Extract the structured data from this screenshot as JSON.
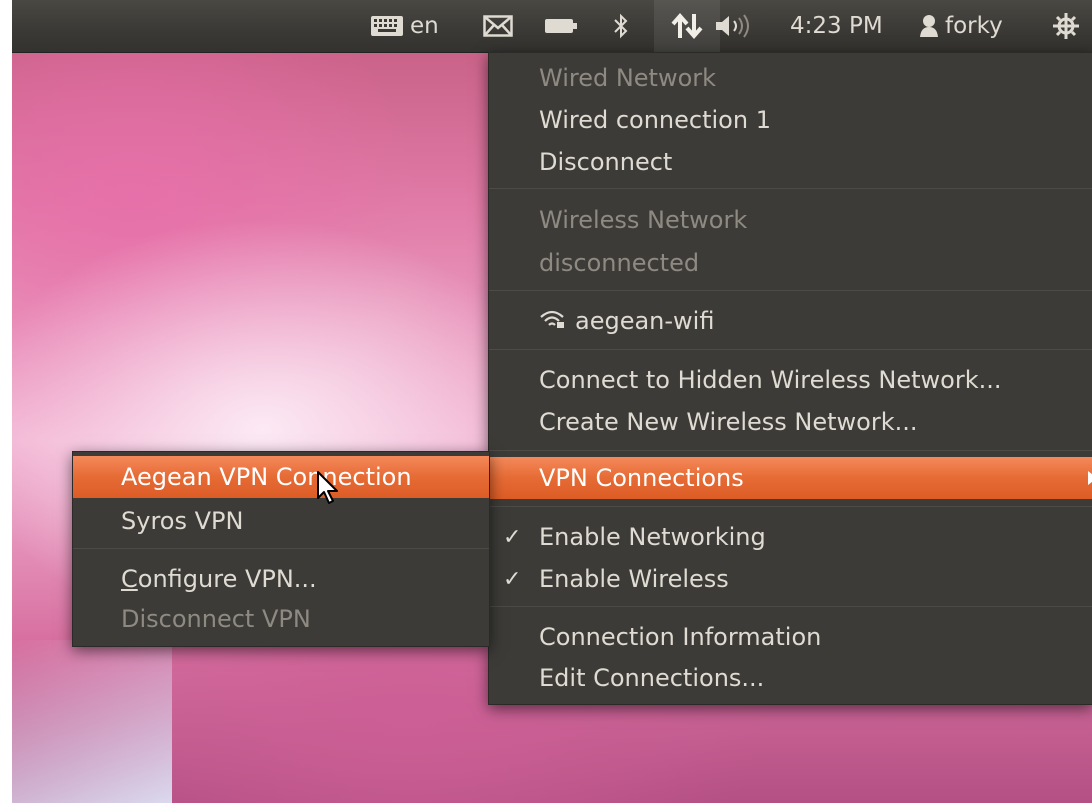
{
  "panel": {
    "keyboard_layout": "en",
    "time": "4:23 PM",
    "user": "forky",
    "icons": [
      "keyboard-icon",
      "mail-icon",
      "battery-icon",
      "bluetooth-icon",
      "network-icon",
      "volume-icon",
      "user-icon",
      "power-icon"
    ]
  },
  "network_menu": {
    "wired_header": "Wired Network",
    "wired_connection": "Wired connection 1",
    "disconnect": "Disconnect",
    "wireless_header": "Wireless Network",
    "wireless_status": "disconnected",
    "wifi_network": "aegean-wifi",
    "connect_hidden": "Connect to Hidden Wireless Network...",
    "create_new": "Create New Wireless Network...",
    "vpn_connections": "VPN Connections",
    "enable_networking": "Enable Networking",
    "enable_wireless": "Enable Wireless",
    "connection_info": "Connection Information",
    "edit_connections": "Edit Connections..."
  },
  "vpn_menu": {
    "aegean_vpn": "Aegean VPN Connection",
    "syros_vpn": "Syros VPN",
    "configure_vpn_mnemonic": "C",
    "configure_vpn_rest": "onfigure VPN...",
    "disconnect_vpn": "Disconnect VPN"
  },
  "colors": {
    "highlight": "#e66b35",
    "menu_bg": "#3c3b37",
    "panel_bg": "#3a3935"
  }
}
